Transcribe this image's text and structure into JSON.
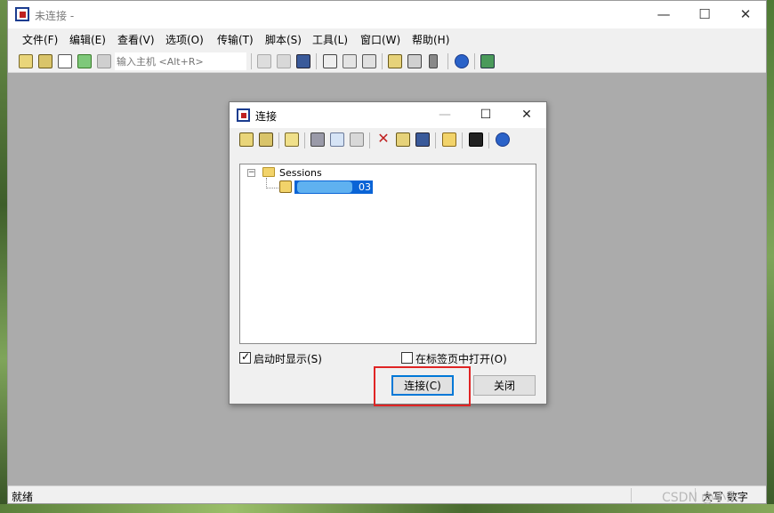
{
  "app": {
    "title": "未连接 -",
    "window_controls": {
      "minimize": "—",
      "maximize": "☐",
      "close": "✕"
    }
  },
  "menu": [
    "文件(F)",
    "编辑(E)",
    "查看(V)",
    "选项(O)",
    "传输(T)",
    "脚本(S)",
    "工具(L)",
    "窗口(W)",
    "帮助(H)"
  ],
  "toolbar": {
    "host_placeholder": "输入主机 <Alt+R>",
    "icons": [
      "connect-icon",
      "quick-connect-icon",
      "connect-tab-icon",
      "reconnect-icon",
      "disconnect-icon",
      "copy-icon",
      "paste-icon",
      "find-icon",
      "print-setup-icon",
      "print-icon",
      "print-screen-icon",
      "session-options-icon",
      "global-options-icon",
      "keymap-icon",
      "help-icon",
      "sftp-icon"
    ]
  },
  "status": {
    "text": "就绪",
    "caps": "大写 数字"
  },
  "watermark": "CSDN @小东.",
  "dialog": {
    "title": "连接",
    "window_controls": {
      "minimize": "—",
      "maximize": "☐",
      "close": "✕"
    },
    "tree": {
      "expander": "−",
      "root_label": "Sessions",
      "session_suffix": "03"
    },
    "show_on_startup": {
      "label": "启动时显示(S)",
      "checked": true
    },
    "open_in_tab": {
      "label": "在标签页中打开(O)",
      "checked": false
    },
    "connect_button": "连接(C)",
    "close_button": "关闭"
  },
  "colors": {
    "workspace": "#ababab",
    "selection": "#0a64d6",
    "highlight_box": "#e02424"
  }
}
